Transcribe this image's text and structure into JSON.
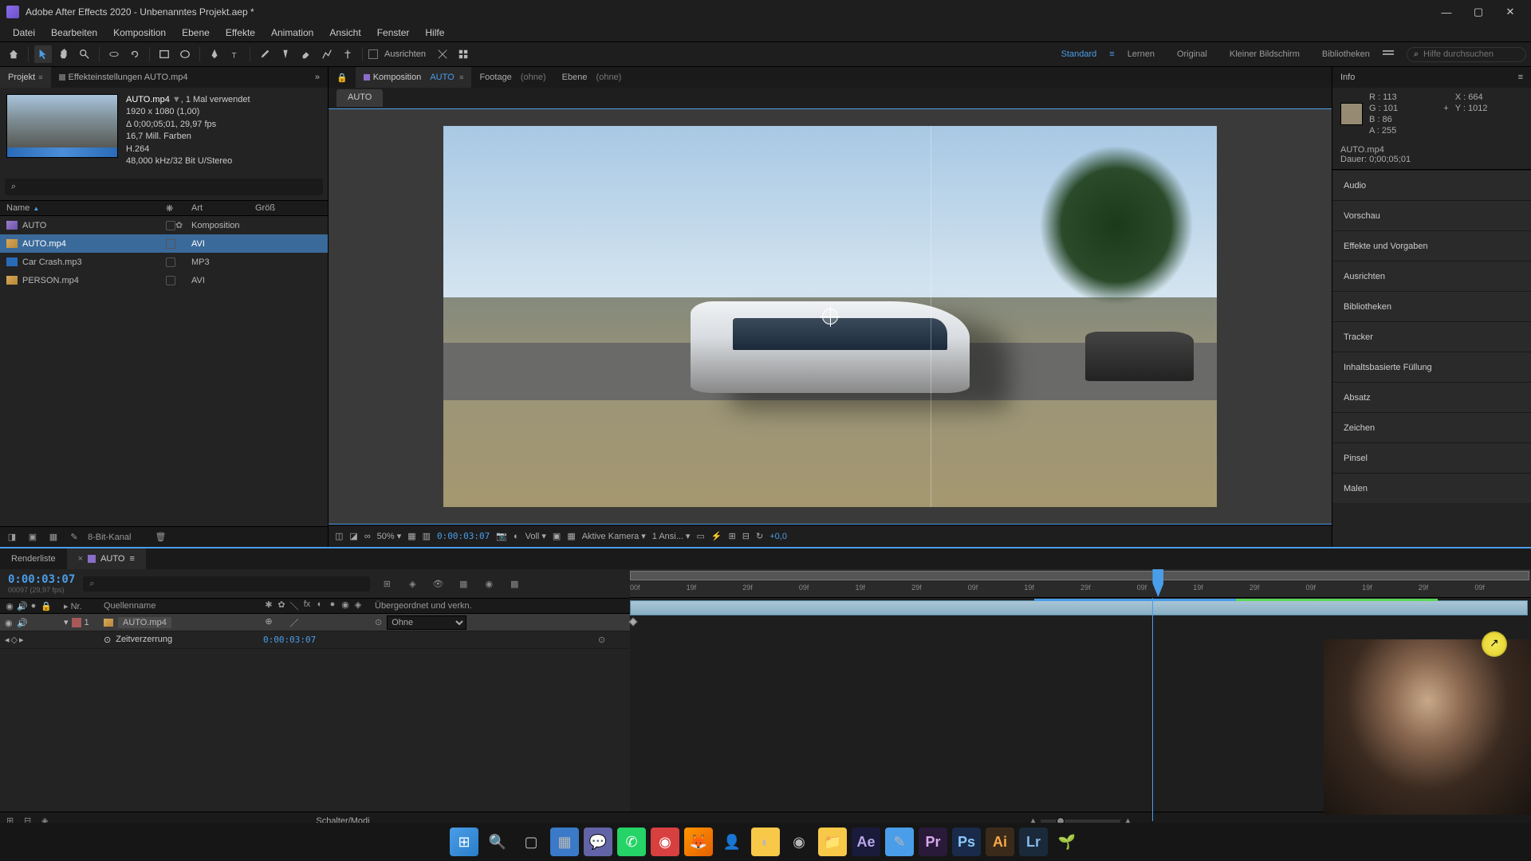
{
  "titlebar": {
    "title": "Adobe After Effects 2020 - Unbenanntes Projekt.aep *"
  },
  "menubar": [
    "Datei",
    "Bearbeiten",
    "Komposition",
    "Ebene",
    "Effekte",
    "Animation",
    "Ansicht",
    "Fenster",
    "Hilfe"
  ],
  "toolbar": {
    "align_label": "Ausrichten",
    "workspaces": [
      "Standard",
      "Lernen",
      "Original",
      "Kleiner Bildschirm",
      "Bibliotheken"
    ],
    "active_workspace": 0,
    "search_placeholder": "Hilfe durchsuchen"
  },
  "project": {
    "tab_project": "Projekt",
    "tab_effects": "Effekteinstellungen AUTO.mp4",
    "info": {
      "name": "AUTO.mp4",
      "used": ", 1 Mal verwendet",
      "dims": "1920 x 1080 (1,00)",
      "dur": "Δ 0;00;05;01, 29,97 fps",
      "colors": "16,7 Mill. Farben",
      "codec": "H.264",
      "audio": "48,000 kHz/32 Bit U/Stereo"
    },
    "cols": {
      "name": "Name",
      "type": "Art",
      "size": "Größ"
    },
    "items": [
      {
        "name": "AUTO",
        "type": "Komposition",
        "icon": "comp",
        "selected": false,
        "col3": "✿"
      },
      {
        "name": "AUTO.mp4",
        "type": "AVI",
        "icon": "avi",
        "selected": true,
        "col3": ""
      },
      {
        "name": "Car Crash.mp3",
        "type": "MP3",
        "icon": "mp3",
        "selected": false,
        "col3": ""
      },
      {
        "name": "PERSON.mp4",
        "type": "AVI",
        "icon": "avi",
        "selected": false,
        "col3": ""
      }
    ],
    "bottom_label": "8-Bit-Kanal"
  },
  "composition": {
    "tab_prefix": "Komposition",
    "tab_name": "AUTO",
    "tab_footage": "Footage",
    "tab_footage_val": "(ohne)",
    "tab_layer": "Ebene",
    "tab_layer_val": "(ohne)",
    "sub_tab": "AUTO",
    "footer": {
      "zoom": "50%",
      "timecode": "0:00:03:07",
      "res": "Voll",
      "camera": "Aktive Kamera",
      "views": "1 Ansi...",
      "exposure": "+0,0"
    }
  },
  "info_panel": {
    "title": "Info",
    "r": "R :",
    "r_val": "113",
    "g": "G :",
    "g_val": "101",
    "b": "B :",
    "b_val": "86",
    "a": "A :",
    "a_val": "255",
    "x": "X :",
    "x_val": "664",
    "y": "Y :",
    "y_val": "1012",
    "file": "AUTO.mp4",
    "dur": "Dauer: 0;00;05;01"
  },
  "right_sections": [
    "Audio",
    "Vorschau",
    "Effekte und Vorgaben",
    "Ausrichten",
    "Bibliotheken",
    "Tracker",
    "Inhaltsbasierte Füllung",
    "Absatz",
    "Zeichen",
    "Pinsel",
    "Malen"
  ],
  "timeline": {
    "tab_render": "Renderliste",
    "tab_comp": "AUTO",
    "timecode": "0:00:03:07",
    "sub_tc": "00097 (29,97 fps)",
    "cols": {
      "nr": "Nr.",
      "source": "Quellenname",
      "parent": "Übergeordnet und verkn."
    },
    "layer": {
      "nr": "1",
      "name": "AUTO.mp4",
      "parent": "Ohne",
      "prop_name": "Zeitverzerrung",
      "prop_val": "0:00:03:07"
    },
    "ruler_ticks": [
      "00f",
      "19f",
      "29f",
      "09f",
      "19f",
      "29f",
      "09f",
      "19f",
      "29f",
      "09f",
      "19f",
      "29f",
      "09f",
      "19f",
      "29f",
      "09f"
    ],
    "playhead_pct": 58,
    "bottom_label": "Schalter/Modi"
  }
}
